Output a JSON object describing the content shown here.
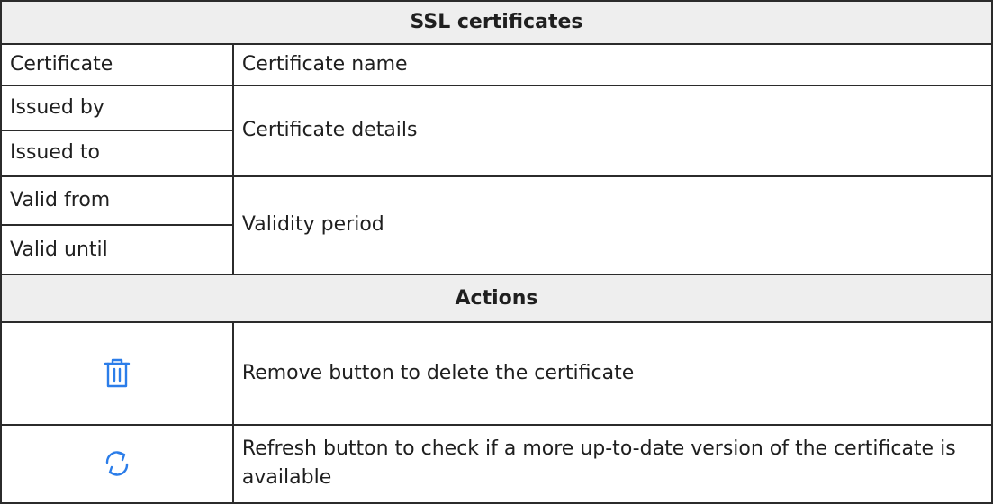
{
  "table": {
    "ssl_header": "SSL certificates",
    "rows": {
      "certificate": {
        "label": "Certificate",
        "description": "Certificate name"
      },
      "issued_by": {
        "label": "Issued by"
      },
      "issued_to": {
        "label": "Issued to"
      },
      "issuer_description": "Certificate details",
      "valid_from": {
        "label": "Valid from"
      },
      "valid_until": {
        "label": "Valid until"
      },
      "validity_description": "Validity period"
    },
    "actions_header": "Actions",
    "actions": {
      "remove": {
        "icon": "trash-icon",
        "description": "Remove button to delete the certificate"
      },
      "refresh": {
        "icon": "refresh-icon",
        "description": "Refresh button to check if a more up-to-date version of the certificate is available"
      }
    }
  },
  "colors": {
    "icon_accent": "#2b7de9",
    "header_background": "#eeeeee",
    "border": "#2b2b2b"
  }
}
